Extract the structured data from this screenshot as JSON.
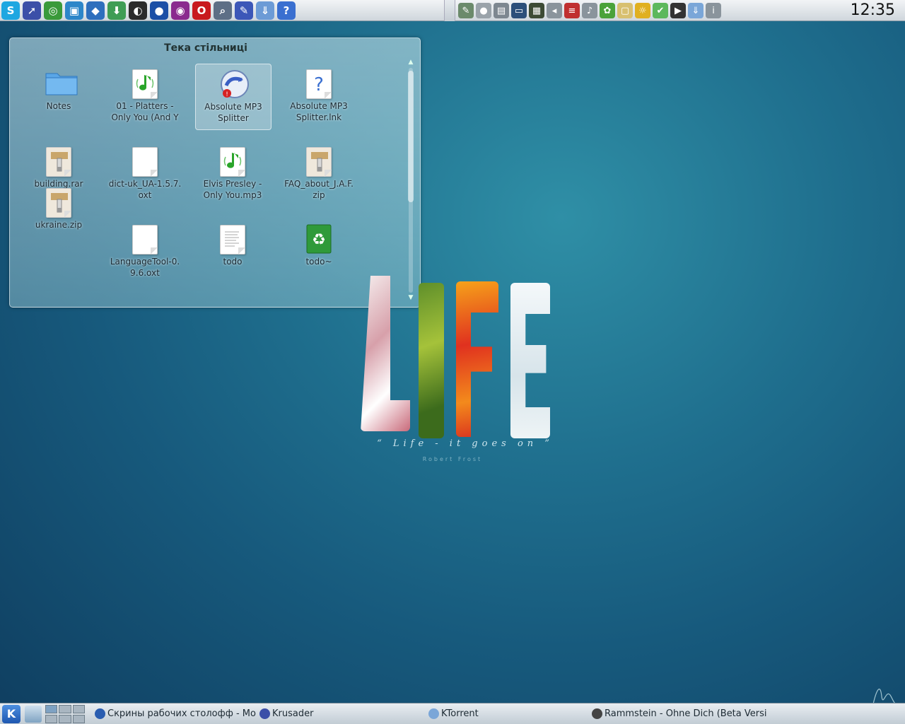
{
  "top_panel": {
    "launchers": [
      {
        "name": "skype-icon",
        "glyph": "S",
        "color": "#1ea7e1"
      },
      {
        "name": "pointer-tool-icon",
        "glyph": "➚",
        "color": "#3b4fa8"
      },
      {
        "name": "network-icon",
        "glyph": "◎",
        "color": "#3a9a3a"
      },
      {
        "name": "image-viewer-icon",
        "glyph": "▣",
        "color": "#2d86c9"
      },
      {
        "name": "blue-app-icon",
        "glyph": "◆",
        "color": "#2e6fbd"
      },
      {
        "name": "download-icon",
        "glyph": "⬇",
        "color": "#3f9d55"
      },
      {
        "name": "black-circle-app-icon",
        "glyph": "◐",
        "color": "#2b2b2b"
      },
      {
        "name": "globe-icon",
        "glyph": "●",
        "color": "#1b4fa6"
      },
      {
        "name": "eye-app-icon",
        "glyph": "◉",
        "color": "#8a2a8e"
      },
      {
        "name": "opera-icon",
        "glyph": "O",
        "color": "#c8191e"
      },
      {
        "name": "search-magnifier-icon",
        "glyph": "⌕",
        "color": "#5d6f86"
      },
      {
        "name": "edit-tool-icon",
        "glyph": "✎",
        "color": "#3c57b8"
      },
      {
        "name": "ktorrent-icon",
        "glyph": "⇓",
        "color": "#6c9bd6"
      },
      {
        "name": "help-icon",
        "glyph": "?",
        "color": "#3a6fd0"
      }
    ],
    "tray": [
      {
        "name": "pen-tray-icon",
        "glyph": "✎",
        "color": "#6b8a6b"
      },
      {
        "name": "record-tray-icon",
        "glyph": "●",
        "color": "#9aa3aa"
      },
      {
        "name": "clipboard-tray-icon",
        "glyph": "▤",
        "color": "#7d8790"
      },
      {
        "name": "monitor-tray-icon",
        "glyph": "▭",
        "color": "#2c4f7a"
      },
      {
        "name": "system-monitor-tray-icon",
        "glyph": "▦",
        "color": "#3d4b35"
      },
      {
        "name": "arrow-left-tray-icon",
        "glyph": "◂",
        "color": "#8a949c"
      },
      {
        "name": "keyboard-layout-flag-icon",
        "glyph": "≡",
        "color": "#c03030"
      },
      {
        "name": "volume-icon",
        "glyph": "♪",
        "color": "#8a949c"
      },
      {
        "name": "green-app-tray-icon",
        "glyph": "✿",
        "color": "#4aa23a"
      },
      {
        "name": "notes-tray-icon",
        "glyph": "▢",
        "color": "#d8c070"
      },
      {
        "name": "bulb-tray-icon",
        "glyph": "☼",
        "color": "#e0b020"
      },
      {
        "name": "check-tray-icon",
        "glyph": "✔",
        "color": "#5cb85c"
      },
      {
        "name": "media-play-tray-icon",
        "glyph": "▶",
        "color": "#333333"
      },
      {
        "name": "download-tray-icon",
        "glyph": "⇓",
        "color": "#7aa6d8"
      },
      {
        "name": "info-tray-icon",
        "glyph": "i",
        "color": "#8a949c"
      }
    ],
    "clock": "12:35"
  },
  "folder_view": {
    "title": "Тека стільниці",
    "items": [
      {
        "label": "Notes",
        "icon": "folder-icon",
        "kind": "folder"
      },
      {
        "label": "01 - Platters -\nOnly You (And Y",
        "icon": "audio-file-icon",
        "kind": "audio"
      },
      {
        "label": "Absolute MP3\nSplitter",
        "icon": "mp3-splitter-icon",
        "kind": "app",
        "selected": true
      },
      {
        "label": "Absolute MP3\nSplitter.lnk",
        "icon": "unknown-file-icon",
        "kind": "unknown"
      },
      {
        "label": "building.rar",
        "icon": "archive-icon",
        "kind": "archive"
      },
      {
        "label": "dict-uk_UA-1.5.7.\noxt",
        "icon": "blank-file-icon",
        "kind": "blank"
      },
      {
        "label": "Elvis Presley -\nOnly You.mp3",
        "icon": "audio-file-icon",
        "kind": "audio"
      },
      {
        "label": "FAQ_about_J.A.F.\nzip",
        "icon": "archive-icon",
        "kind": "archive"
      },
      {
        "label": "ukraine.zip",
        "icon": "archive-icon",
        "kind": "archive"
      },
      {
        "label": "LanguageTool-0.\n9.6.oxt",
        "icon": "blank-file-icon",
        "kind": "blank"
      },
      {
        "label": "todo",
        "icon": "text-file-icon",
        "kind": "text"
      },
      {
        "label": "todo~",
        "icon": "recycle-file-icon",
        "kind": "recycle"
      }
    ],
    "scroll_fraction": 0.0
  },
  "wallpaper": {
    "quote": "“ Life - it goes on ”",
    "author": "Robert Frost"
  },
  "bottom_panel": {
    "kmenu_label": "K",
    "pager_active": 0,
    "tasks": [
      {
        "label": "Скрины рабочих столофф - Mozilla",
        "icon": "firefox-icon",
        "color": "#2a5db0"
      },
      {
        "label": "Krusader",
        "icon": "krusader-icon",
        "color": "#3b4fa8"
      },
      {
        "label": "KTorrent",
        "icon": "ktorrent-icon",
        "color": "#7aa6d8"
      },
      {
        "label": "Rammstein - Ohne Dich (Beta Version)",
        "icon": "media-player-icon",
        "color": "#444444"
      }
    ]
  },
  "colors": {
    "desktop_bg": "#1f6f8e",
    "panel_bg": "#dde3e8"
  }
}
